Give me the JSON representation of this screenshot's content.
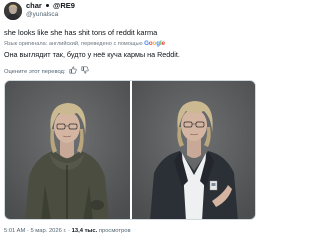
{
  "header": {
    "display_name": "char",
    "name_suffix": "@RE9",
    "handle": "@yunalsca"
  },
  "tweet": {
    "text": "she looks like she has shit tons of reddit karma",
    "translation_note_prefix": "Язык оригинала: английский, переведено с помощью",
    "translation_note_brand": "Google",
    "translated_text": "Она выглядит так, будто у неё куча кармы на Reddit.",
    "rate_label": "Оцените этот перевод:"
  },
  "footer": {
    "time": "5:01 AM",
    "date": "5 мар. 2026 г.",
    "separator": "·",
    "views_count": "13,4 тыс.",
    "views_label": "просмотров"
  },
  "colors": {
    "text": "#0f1419",
    "secondary": "#536471",
    "google_blue": "#4285f4",
    "google_red": "#ea4335",
    "google_yellow": "#fbbc05",
    "google_green": "#34a853"
  },
  "icons": {
    "thumbs_up": "thumbs-up-icon",
    "thumbs_down": "thumbs-down-icon"
  }
}
